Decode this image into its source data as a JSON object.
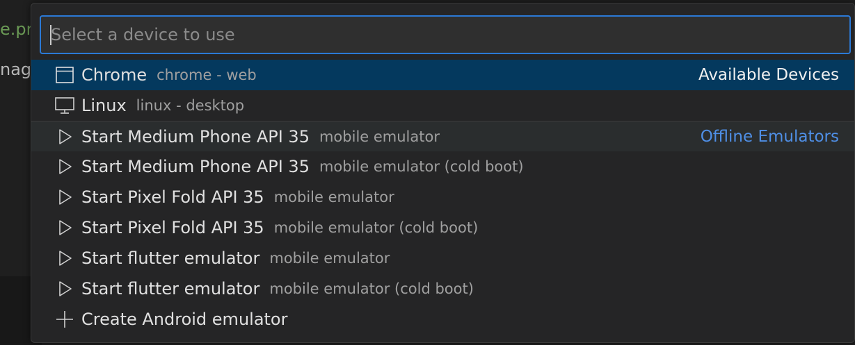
{
  "editor": {
    "line1": "e.pr",
    "line2": "nage"
  },
  "picker": {
    "search": {
      "placeholder": "Select a device to use",
      "value": ""
    },
    "items": [
      {
        "icon": "browser-window-icon",
        "label": "Chrome",
        "description": "chrome - web",
        "group": "Available Devices",
        "state": "selected"
      },
      {
        "icon": "monitor-icon",
        "label": "Linux",
        "description": "linux - desktop",
        "group": "",
        "state": "normal"
      },
      {
        "icon": "play-icon",
        "label": "Start Medium Phone API 35",
        "description": "mobile emulator",
        "group": "Offline Emulators",
        "state": "hovered"
      },
      {
        "icon": "play-icon",
        "label": "Start Medium Phone API 35",
        "description": "mobile emulator (cold boot)",
        "group": "",
        "state": "normal"
      },
      {
        "icon": "play-icon",
        "label": "Start Pixel Fold API 35",
        "description": "mobile emulator",
        "group": "",
        "state": "normal"
      },
      {
        "icon": "play-icon",
        "label": "Start Pixel Fold API 35",
        "description": "mobile emulator (cold boot)",
        "group": "",
        "state": "normal"
      },
      {
        "icon": "play-icon",
        "label": "Start flutter emulator",
        "description": "mobile emulator",
        "group": "",
        "state": "normal"
      },
      {
        "icon": "play-icon",
        "label": "Start flutter emulator",
        "description": "mobile emulator (cold boot)",
        "group": "",
        "state": "normal"
      },
      {
        "icon": "plus-icon",
        "label": "Create Android emulator",
        "description": "",
        "group": "",
        "state": "normal"
      }
    ]
  },
  "colors": {
    "selection": "#04395e",
    "focus_border": "#2b79d6",
    "group_accent": "#4f8fe6"
  }
}
